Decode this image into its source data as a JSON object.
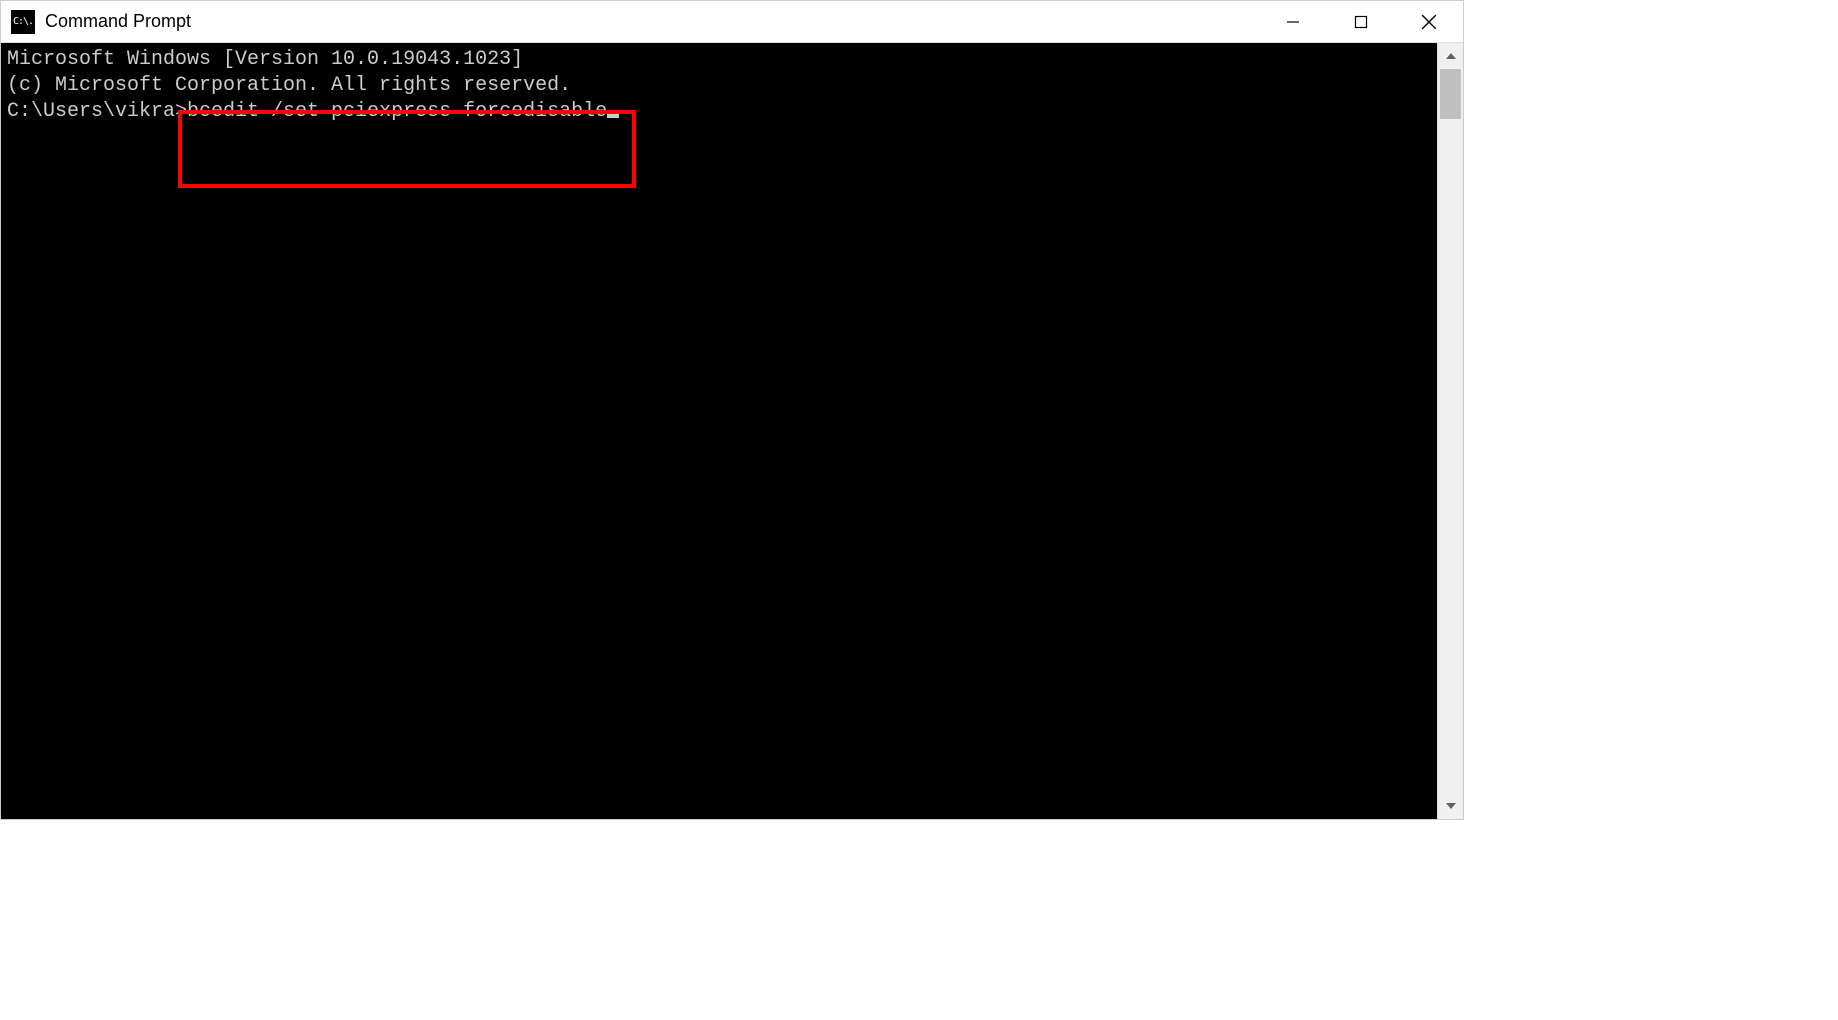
{
  "window": {
    "title": "Command Prompt",
    "icon_label": "C:\\."
  },
  "terminal": {
    "line1": "Microsoft Windows [Version 10.0.19043.1023]",
    "line2": "(c) Microsoft Corporation. All rights reserved.",
    "blank": "",
    "prompt": "C:\\Users\\vikra>",
    "command": "bcedit /set pciexpress forcedisable"
  }
}
